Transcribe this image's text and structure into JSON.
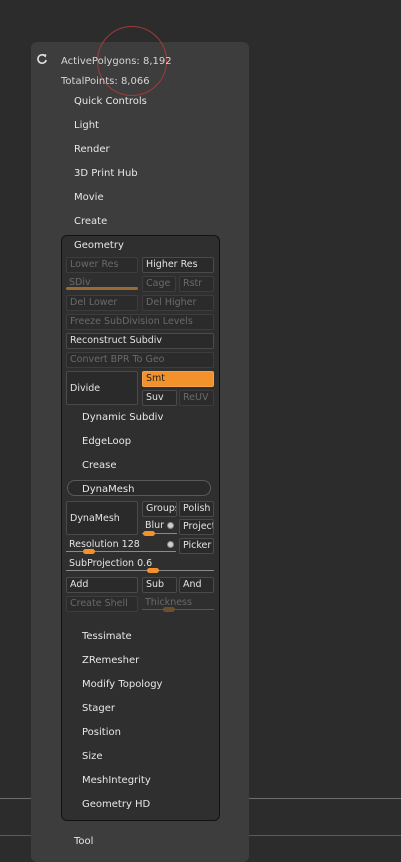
{
  "stats": {
    "active_polygons": "ActivePolygons: 8,192",
    "total_points": "TotalPoints: 8,066"
  },
  "menu": {
    "quick_controls": "Quick Controls",
    "light": "Light",
    "render": "Render",
    "print_hub": "3D Print Hub",
    "movie": "Movie",
    "create": "Create",
    "tool": "Tool"
  },
  "geometry": {
    "title": "Geometry",
    "lower_res": "Lower Res",
    "higher_res": "Higher Res",
    "sdiv": "SDiv",
    "cage": "Cage",
    "rstr": "Rstr",
    "del_lower": "Del Lower",
    "del_higher": "Del Higher",
    "freeze": "Freeze SubDivision Levels",
    "reconstruct": "Reconstruct Subdiv",
    "convert_bpr": "Convert BPR To Geo",
    "divide": "Divide",
    "smt": "Smt",
    "suv": "Suv",
    "reuv": "ReUV",
    "dynamic_subdiv": "Dynamic Subdiv",
    "edgeloop": "EdgeLoop",
    "crease": "Crease",
    "dynamesh_header": "DynaMesh",
    "dynamesh_btn": "DynaMesh",
    "groups": "Groups",
    "polish": "Polish",
    "blur": "Blur",
    "project": "Project",
    "resolution": "Resolution 128",
    "picker": "Picker",
    "subprojection": "SubProjection 0.6",
    "add": "Add",
    "sub": "Sub",
    "and": "And",
    "create_shell": "Create Shell",
    "thickness": "Thickness",
    "tessimate": "Tessimate",
    "zremesher": "ZRemesher",
    "modify_topology": "Modify Topology",
    "stager": "Stager",
    "position": "Position",
    "size": "Size",
    "meshintegrity": "MeshIntegrity",
    "geometry_hd": "Geometry HD"
  },
  "colors": {
    "accent": "#f3922b",
    "panel": "#3d3d3d",
    "background": "#2c2c2c"
  }
}
